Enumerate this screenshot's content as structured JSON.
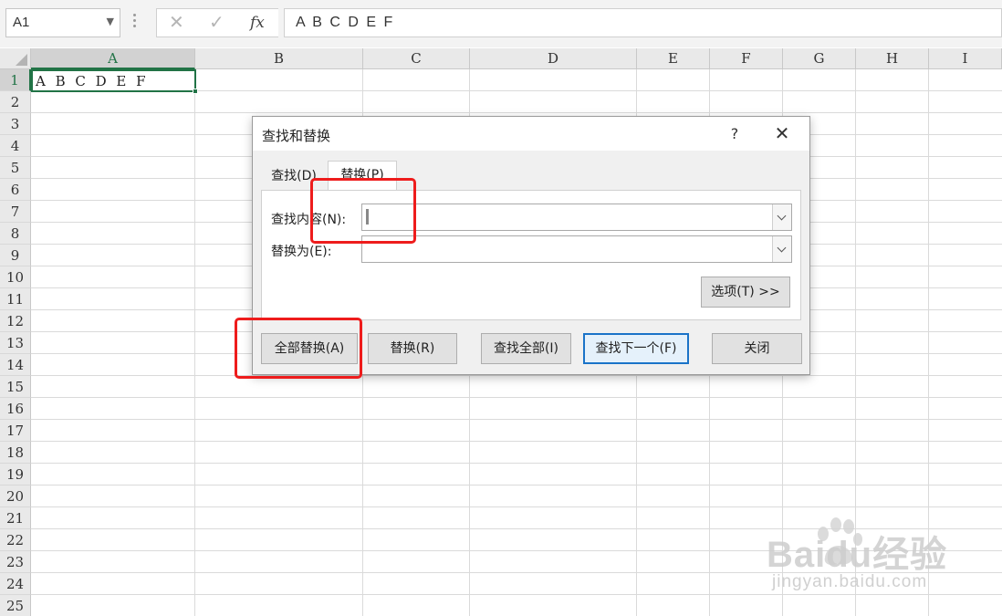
{
  "formula_bar": {
    "name_box": "A1",
    "cancel_icon": "close-icon",
    "confirm_icon": "check-icon",
    "fx_label": "fx",
    "formula": "A B C D E F"
  },
  "sheet": {
    "columns": [
      "A",
      "B",
      "C",
      "D",
      "E",
      "F",
      "G",
      "H",
      "I"
    ],
    "rows": [
      "1",
      "2",
      "3",
      "4",
      "5",
      "6",
      "7",
      "8",
      "9",
      "10",
      "11",
      "12",
      "13",
      "14",
      "15",
      "16",
      "17",
      "18",
      "19",
      "20",
      "21",
      "22",
      "23",
      "24",
      "25"
    ],
    "selected_cell": "A1",
    "a1_value": "A B C D E F"
  },
  "dialog": {
    "title": "查找和替换",
    "help": "?",
    "close": "✕",
    "tabs": {
      "find": "查找(D)",
      "replace": "替换(P)",
      "active": "replace"
    },
    "find_label": "查找内容(N):",
    "find_value": "",
    "replace_label": "替换为(E):",
    "replace_value": "",
    "options_button": "选项(T) >>",
    "buttons": {
      "replace_all": "全部替换(A)",
      "replace": "替换(R)",
      "find_all": "查找全部(I)",
      "find_next": "查找下一个(F)",
      "close": "关闭"
    }
  },
  "watermark": {
    "brand": "Baidu经验",
    "url": "jingyan.baidu.com"
  },
  "colors": {
    "highlight": "#ee1c1c",
    "selection": "#217346",
    "primary_button_border": "#1a73c8"
  }
}
